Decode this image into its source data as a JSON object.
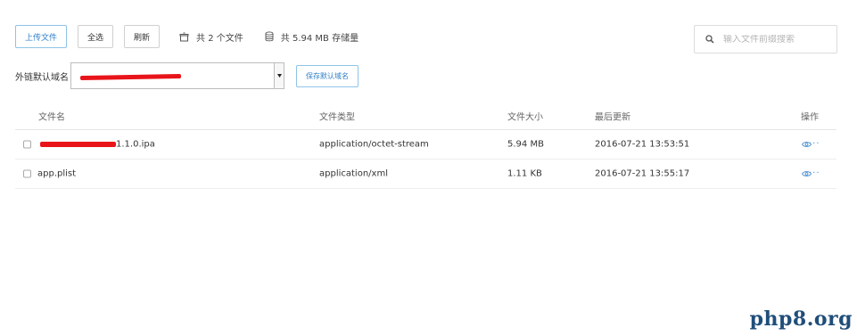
{
  "toolbar": {
    "upload_label": "上传文件",
    "select_all_label": "全选",
    "refresh_label": "刷新",
    "file_count_text": "共 2 个文件",
    "storage_text": "共 5.94 MB 存储量"
  },
  "search": {
    "placeholder": "输入文件前缀搜索",
    "value": ""
  },
  "domain": {
    "label": "外链默认域名",
    "selected_value": "",
    "save_label": "保存默认域名"
  },
  "table": {
    "headers": {
      "name": "文件名",
      "type": "文件类型",
      "size": "文件大小",
      "updated": "最后更新",
      "actions": "操作"
    },
    "rows": [
      {
        "name": "1.1.0.ipa",
        "type": "application/octet-stream",
        "size": "5.94 MB",
        "updated": "2016-07-21 13:53:51"
      },
      {
        "name": "app.plist",
        "type": "application/xml",
        "size": "1.11 KB",
        "updated": "2016-07-21 13:55:17"
      }
    ],
    "more_glyph": "···"
  },
  "icons": {
    "files_icon": "box-icon",
    "storage_icon": "database-icon",
    "search_icon": "search-icon",
    "preview_icon": "eye-icon",
    "more_icon": "more-icon",
    "dropdown_icon": "caret-down-icon"
  },
  "colors": {
    "accent": "#2f7fc8",
    "redaction": "#e8141a",
    "watermark": "#1f4e79"
  },
  "watermark": {
    "text": "php8.org"
  }
}
